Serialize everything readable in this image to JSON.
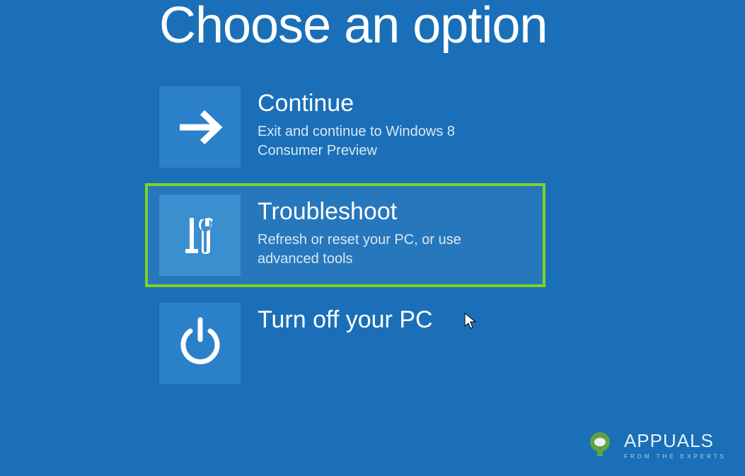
{
  "title": "Choose an option",
  "options": [
    {
      "title": "Continue",
      "desc": "Exit and continue to Windows 8 Consumer Preview"
    },
    {
      "title": "Troubleshoot",
      "desc": "Refresh or reset your PC, or use advanced tools"
    },
    {
      "title": "Turn off your PC",
      "desc": ""
    }
  ],
  "watermark": {
    "brand": "APPUALS",
    "tagline": "FROM THE EXPERTS"
  }
}
